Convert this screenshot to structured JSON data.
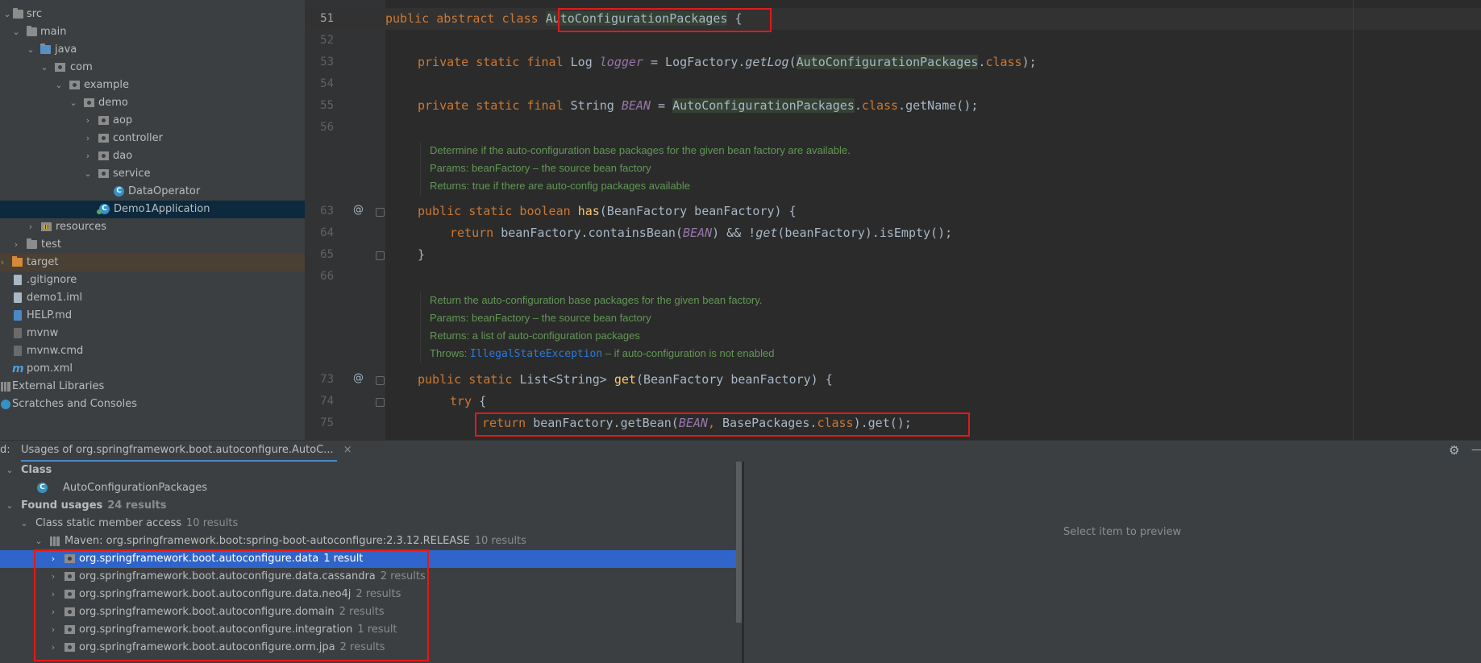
{
  "project_tree": {
    "items": [
      {
        "label": "src"
      },
      {
        "label": "main"
      },
      {
        "label": "java"
      },
      {
        "label": "com"
      },
      {
        "label": "example"
      },
      {
        "label": "demo"
      },
      {
        "label": "aop"
      },
      {
        "label": "controller"
      },
      {
        "label": "dao"
      },
      {
        "label": "service"
      },
      {
        "label": "DataOperator"
      },
      {
        "label": "Demo1Application"
      },
      {
        "label": "resources"
      },
      {
        "label": "test"
      },
      {
        "label": "target"
      },
      {
        "label": ".gitignore"
      },
      {
        "label": "demo1.iml"
      },
      {
        "label": "HELP.md"
      },
      {
        "label": "mvnw"
      },
      {
        "label": "mvnw.cmd"
      },
      {
        "label": "pom.xml"
      },
      {
        "label": "External Libraries"
      },
      {
        "label": "Scratches and Consoles"
      }
    ]
  },
  "editor": {
    "line_numbers": [
      "51",
      "52",
      "53",
      "54",
      "55",
      "56",
      "63",
      "64",
      "65",
      "66",
      "73",
      "74",
      "75"
    ],
    "code": {
      "l51": {
        "kw": "public abstract class ",
        "name": "AutoConfigurationPackages",
        "rest": " {"
      },
      "l53": {
        "kw": "private static final ",
        "type": "Log ",
        "field": "logger",
        "eq": " = LogFactory.",
        "call": "getLog",
        "open": "(",
        "cls": "AutoConfigurationPackages",
        "dot": ".",
        "ckw": "class",
        "end": ");"
      },
      "l55": {
        "kw": "private static final ",
        "type": "String ",
        "field": "BEAN",
        "eq": " = ",
        "cls": "AutoConfigurationPackages",
        "dot": ".",
        "ckw": "class",
        "end": ".getName();"
      },
      "l63": {
        "kw": "public static boolean ",
        "fn": "has",
        "rest": "(BeanFactory beanFactory) {"
      },
      "l64": {
        "kw": "return ",
        "a": "beanFactory.containsBean(",
        "field": "BEAN",
        "b": ") && !",
        "call": "get",
        "c": "(beanFactory).isEmpty();"
      },
      "l65": {
        "text": "}"
      },
      "l73": {
        "kw": "public static ",
        "type": "List<String> ",
        "fn": "get",
        "rest": "(BeanFactory beanFactory) {"
      },
      "l74": {
        "kw": "try",
        "rest": " {"
      },
      "l75": {
        "kw": "return ",
        "a": "beanFactory.getBean(",
        "field": "BEAN",
        "comma": ", ",
        "b": "BasePackages.",
        "ckw": "class",
        "c": ").get();"
      }
    },
    "doc1": {
      "line1": "Determine if the auto-configuration base packages for the given bean factory are available.",
      "line2": "Params:  beanFactory – the source bean factory",
      "line3": "Returns: true if there are auto-config packages available"
    },
    "doc2": {
      "line1": "Return the auto-configuration base packages for the given bean factory.",
      "line2": "Params:  beanFactory – the source bean factory",
      "line3": "Returns: a list of auto-configuration packages",
      "line4_label": "Throws:  ",
      "line4_link": "IllegalStateException",
      "line4_rest": " – if auto-configuration is not enabled"
    },
    "gutter_at": "@"
  },
  "find_panel": {
    "prefix": "d:",
    "tab_label": "Usages of org.springframework.boot.autoconfigure.AutoC...",
    "close": "×",
    "gear": "⚙",
    "minimize": "—",
    "class_header": "Class",
    "class_item": "AutoConfigurationPackages",
    "found_usages": "Found usages",
    "found_count": "24 results",
    "static_access": "Class static member access",
    "static_count": "10 results",
    "maven": "Maven: org.springframework.boot:spring-boot-autoconfigure:2.3.12.RELEASE",
    "maven_count": "10 results",
    "packages": [
      {
        "name": "org.springframework.boot.autoconfigure.data",
        "count": "1 result"
      },
      {
        "name": "org.springframework.boot.autoconfigure.data.cassandra",
        "count": "2 results"
      },
      {
        "name": "org.springframework.boot.autoconfigure.data.neo4j",
        "count": "2 results"
      },
      {
        "name": "org.springframework.boot.autoconfigure.domain",
        "count": "2 results"
      },
      {
        "name": "org.springframework.boot.autoconfigure.integration",
        "count": "1 result"
      },
      {
        "name": "org.springframework.boot.autoconfigure.orm.jpa",
        "count": "2 results"
      }
    ],
    "preview_text": "Select item to preview"
  }
}
